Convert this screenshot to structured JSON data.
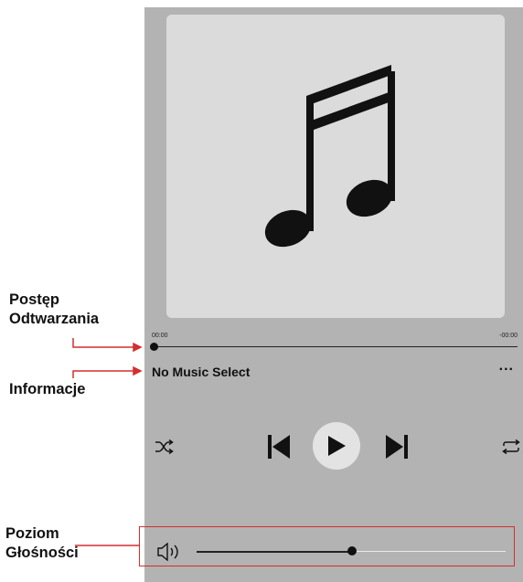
{
  "player": {
    "time_elapsed": "00:00",
    "time_remaining": "-00:00",
    "track_title": "No Music Select",
    "more_label": "...",
    "progress": 0,
    "volume": 0.52
  },
  "annotations": {
    "progress_line1": "Postęp",
    "progress_line2": "Odtwarzania",
    "info": "Informacje",
    "volume_line1": "Poziom",
    "volume_line2": "Głośności"
  },
  "colors": {
    "panel": "#b3b3b3",
    "artwork": "#dbdbdb",
    "annotation": "#d32f2f",
    "icon": "#111111"
  },
  "icons": [
    "music-note-icon",
    "shuffle-icon",
    "previous-icon",
    "play-icon",
    "next-icon",
    "repeat-icon",
    "speaker-icon"
  ]
}
